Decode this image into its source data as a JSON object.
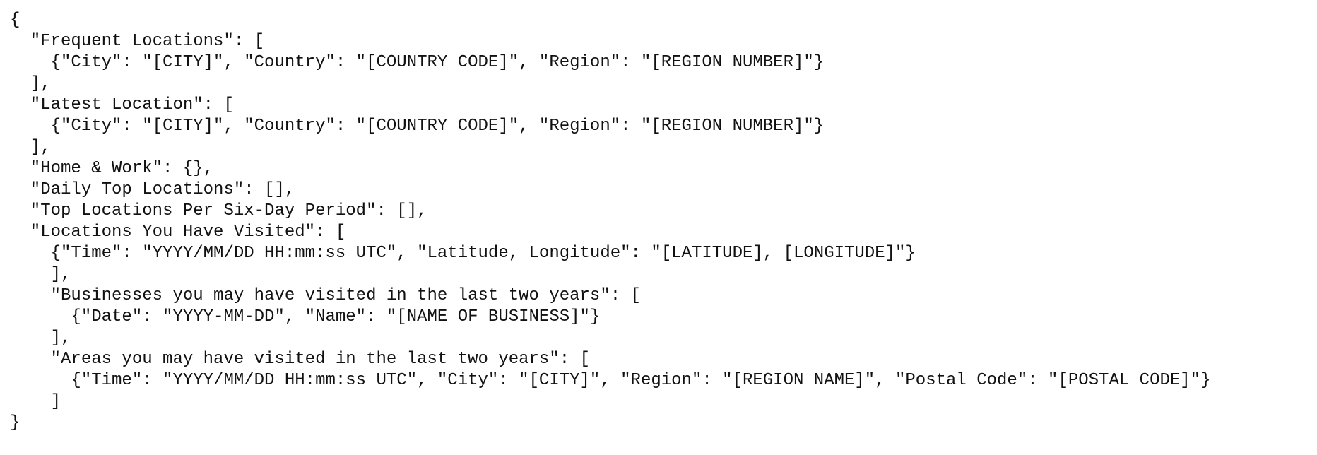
{
  "document": {
    "lines": [
      "{",
      "  \"Frequent Locations\": [",
      "    {\"City\": \"[CITY]\", \"Country\": \"[COUNTRY CODE]\", \"Region\": \"[REGION NUMBER]\"}",
      "  ],",
      "  \"Latest Location\": [",
      "    {\"City\": \"[CITY]\", \"Country\": \"[COUNTRY CODE]\", \"Region\": \"[REGION NUMBER]\"}",
      "  ],",
      "  \"Home & Work\": {},",
      "  \"Daily Top Locations\": [],",
      "  \"Top Locations Per Six-Day Period\": [],",
      "  \"Locations You Have Visited\": [",
      "    {\"Time\": \"YYYY/MM/DD HH:mm:ss UTC\", \"Latitude, Longitude\": \"[LATITUDE], [LONGITUDE]\"}",
      "    ],",
      "    \"Businesses you may have visited in the last two years\": [",
      "      {\"Date\": \"YYYY-MM-DD\", \"Name\": \"[NAME OF BUSINESS]\"}",
      "    ],",
      "    \"Areas you may have visited in the last two years\": [",
      "      {\"Time\": \"YYYY/MM/DD HH:mm:ss UTC\", \"City\": \"[CITY]\", \"Region\": \"[REGION NAME]\", \"Postal Code\": \"[POSTAL CODE]\"}",
      "    ]",
      "}"
    ]
  }
}
